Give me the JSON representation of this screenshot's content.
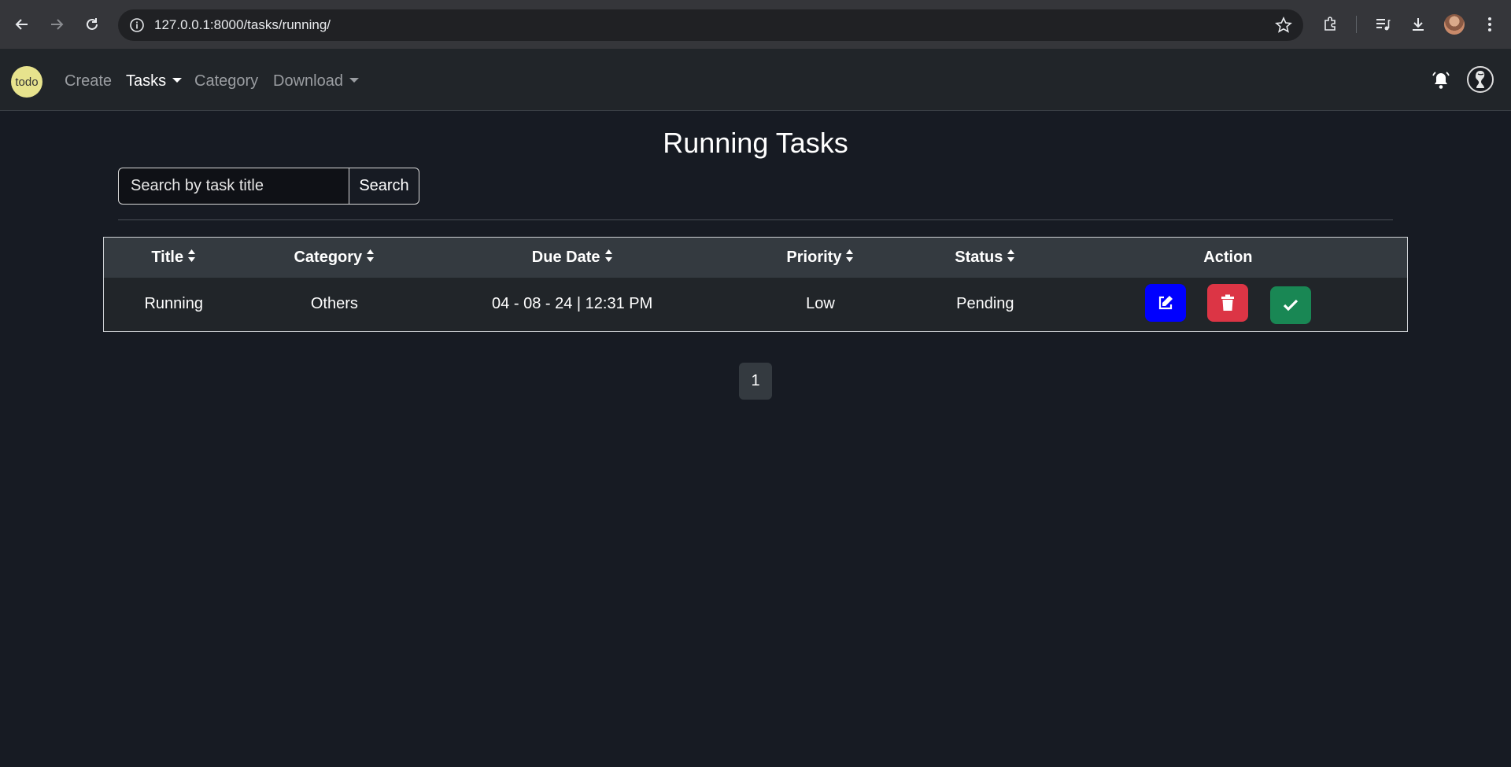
{
  "browser": {
    "url": "127.0.0.1:8000/tasks/running/"
  },
  "nav": {
    "logo_text": "todo",
    "links": [
      {
        "label": "Create"
      },
      {
        "label": "Tasks"
      },
      {
        "label": "Category"
      },
      {
        "label": "Download"
      }
    ]
  },
  "page": {
    "title": "Running Tasks",
    "search_placeholder": "Search by task title",
    "search_button": "Search"
  },
  "table": {
    "headers": [
      "Title",
      "Category",
      "Due Date",
      "Priority",
      "Status",
      "Action"
    ],
    "rows": [
      {
        "title": "Running",
        "category": "Others",
        "due": "04 - 08 - 24 | 12:31 PM",
        "priority": "Low",
        "status": "Pending"
      }
    ]
  },
  "pagination": {
    "current": "1"
  },
  "colors": {
    "edit": "#0000ff",
    "delete": "#dc3545",
    "complete": "#198754"
  }
}
